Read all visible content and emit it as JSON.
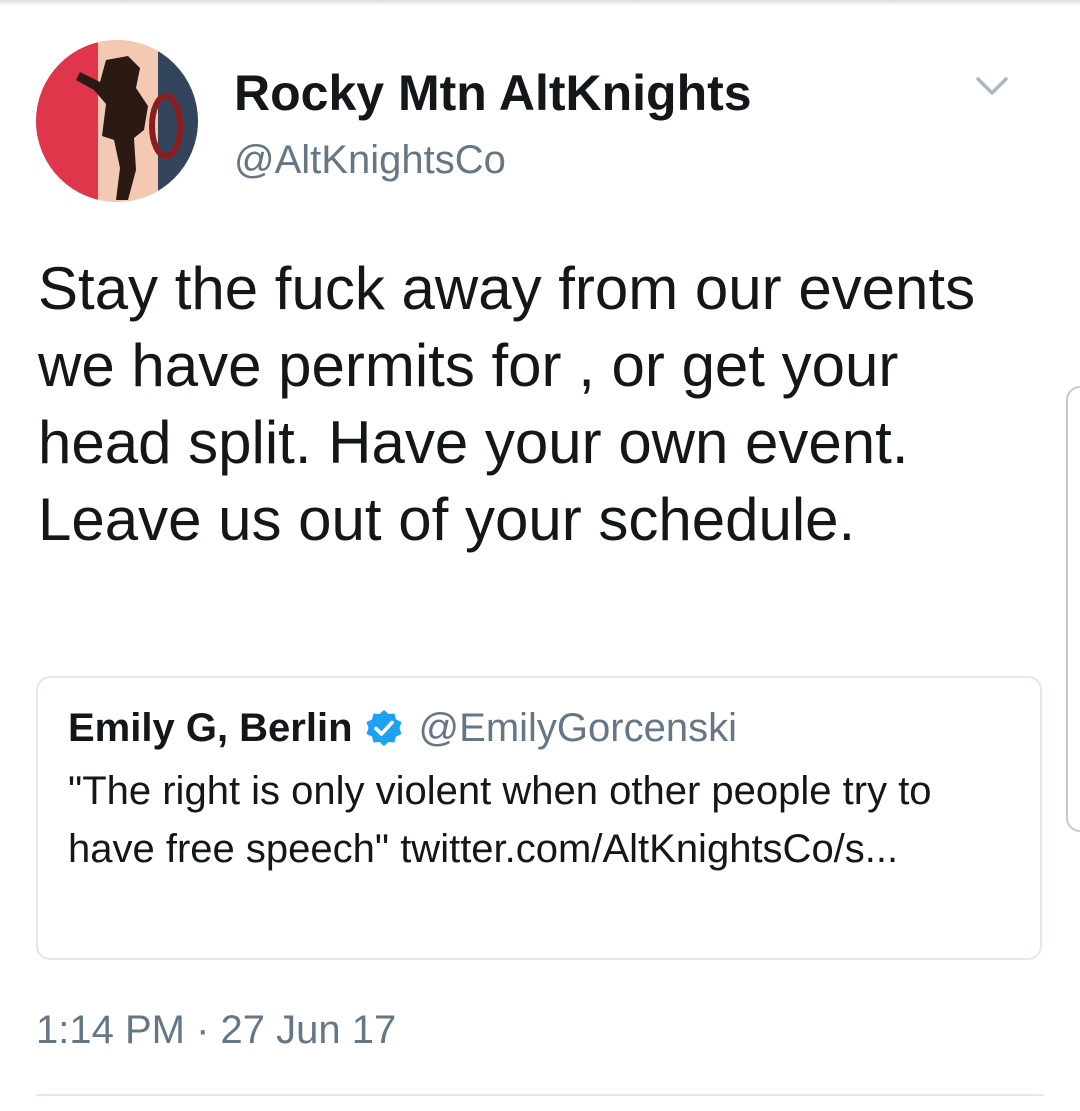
{
  "tweet": {
    "author": {
      "display_name": "Rocky Mtn AltKnights",
      "handle": "@AltKnightsCo",
      "avatar_icon": "profile-avatar"
    },
    "menu_icon": "chevron-down-icon",
    "text": "Stay the fuck away from our events we have permits for , or get your head split. Have your own event. Leave us out of your schedule.",
    "quoted": {
      "display_name": "Emily G, Berlin",
      "verified": true,
      "verified_icon": "verified-badge-icon",
      "handle": "@EmilyGorcenski",
      "text": "\"The right is only violent when other people try to have free speech\" twitter.com/AltKnightsCo/s..."
    },
    "timestamp": "1:14 PM · 27 Jun 17"
  },
  "colors": {
    "text_primary": "#14171a",
    "text_secondary": "#657786",
    "border": "#e1e8ed",
    "verified_blue": "#1da1f2"
  }
}
